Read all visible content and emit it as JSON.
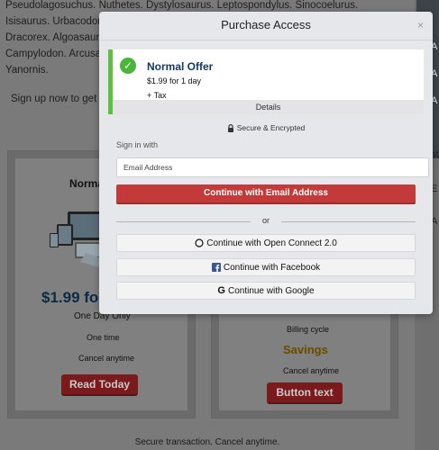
{
  "background": {
    "intro_lines": [
      "Pseudolagosuchus. Nuthetes. Dystylosaurus. Leptospondylus. Sinocoelurus. Isisaurus. Urbacodon.",
      "Dracorex. Algoasaurus.",
      "Campylodon. Arcusaurus.",
      "Yanornis."
    ],
    "signup_text": "Sign up now to get unli",
    "left_card": {
      "title": "Norma",
      "price": "$1.99 fo",
      "period": "One Day Only",
      "billing": "One time",
      "cancel": "Cancel anytime",
      "button": "Read Today"
    },
    "right_card": {
      "billing_label": "Billing cycle",
      "savings": "Savings",
      "cancel": "Cancel anytime",
      "button": "Button text"
    },
    "footer": "Secure transaction. Cancel anytime.",
    "right_strip": [
      "A",
      "A",
      "A",
      "st",
      "E",
      "A"
    ]
  },
  "modal": {
    "title": "Purchase Access",
    "close_label": "×",
    "offer": {
      "title": "Normal Offer",
      "price": "$1.99 for 1 day",
      "tax": "+ Tax",
      "details_label": "Details"
    },
    "secure_label": "Secure & Encrypted",
    "signin_label": "Sign in with",
    "email_placeholder": "Email Address",
    "email_button": "Continue with Email Address",
    "or_label": "or",
    "sso": [
      {
        "label": "Continue with Open Connect 2.0",
        "icon": "circle-icon"
      },
      {
        "label": "Continue with Facebook",
        "icon": "facebook-icon"
      },
      {
        "label": "Continue with Google",
        "icon": "google-icon"
      }
    ]
  },
  "colors": {
    "accent_red": "#c23b3a",
    "offer_green": "#5cc045",
    "offer_title": "#123a63",
    "facebook_blue": "#3b5998"
  }
}
